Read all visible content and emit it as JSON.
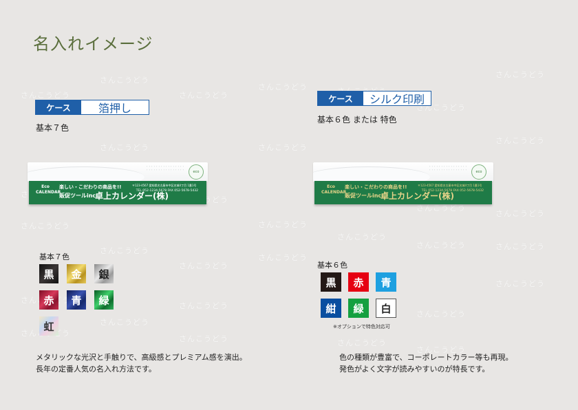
{
  "page_title": "名入れイメージ",
  "watermark_text": "さんこうどう",
  "left": {
    "tag": "ケース",
    "method": "箔押し",
    "base_colors_caption": "基本７色",
    "swatch_label": "基本７色",
    "swatches": [
      {
        "label": "黒",
        "color": "#231815"
      },
      {
        "label": "金",
        "color": "#c9a227"
      },
      {
        "label": "銀",
        "color": "#9a9a9a"
      },
      {
        "label": "赤",
        "color": "#b01a38"
      },
      {
        "label": "青",
        "color": "#1d2e7a"
      },
      {
        "label": "緑",
        "color": "#168a3c"
      },
      {
        "label": "虹",
        "color": "#cfd6e0"
      }
    ],
    "description": [
      "メタリックな光沢と手触りで、高級感とプレミアム感を演出。",
      "長年の定番人気の名入れ方法です。"
    ]
  },
  "right": {
    "tag": "ケース",
    "method": "シルク印刷",
    "base_colors_caption": "基本６色 または 特色",
    "swatch_label": "基本６色",
    "swatches": [
      {
        "label": "黒",
        "color": "#231815"
      },
      {
        "label": "赤",
        "color": "#e60012"
      },
      {
        "label": "青",
        "color": "#1ea0e0"
      },
      {
        "label": "紺",
        "color": "#0a4fa0"
      },
      {
        "label": "緑",
        "color": "#15a040"
      },
      {
        "label": "白",
        "color": "#ffffff"
      }
    ],
    "note": "※オプションで特色対応可",
    "description": [
      "色の種類が豊富で、コーポレートカラー等も再現。",
      "発色がよく文字が読みやすいのが特長です。"
    ]
  },
  "calendar": {
    "eco_logo": "Eco CALENDAR",
    "line1": "楽しい・こだわりの商品を!!",
    "line2": "販促ツールinc.",
    "name": "卓上カレンダー(株)",
    "address": "〒123-4567 愛知県名古屋市中区名城4丁目 1番1号",
    "tel": "TEL 052-1234-5678 FAX 052-5678-5432"
  }
}
